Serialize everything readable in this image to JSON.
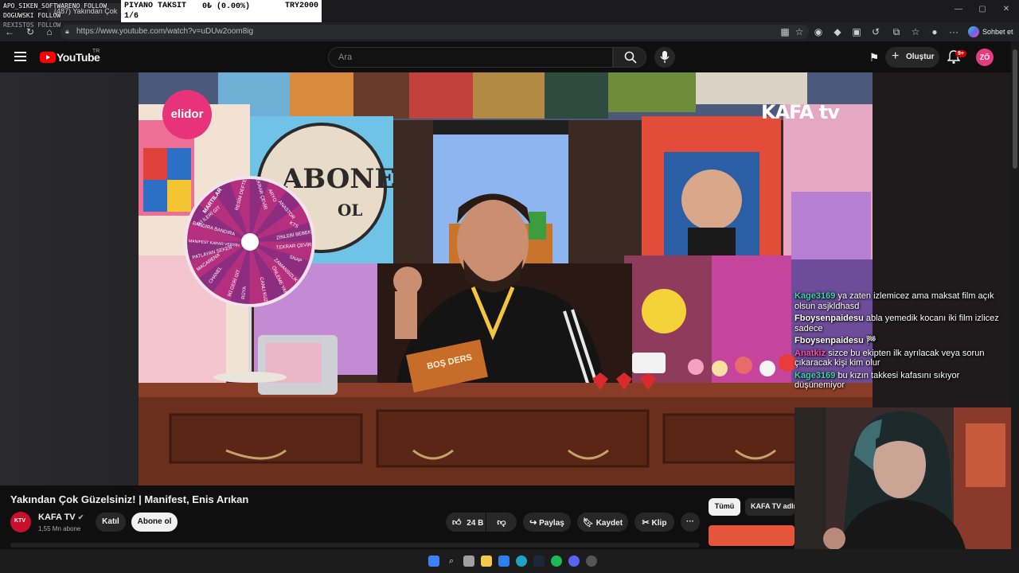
{
  "browser": {
    "tab_partial": "(487) Yakından Çok",
    "url": "https://www.youtube.com/watch?v=uDUw2oom8ig",
    "copilot_label": "Sohbet et"
  },
  "stream_overlay": {
    "follow_lines": [
      "APO_SIKEN_SOFTWARE⁠NO FOLLOW",
      "DOGUWSKI FOLLOW",
      "REXISTOS FOLLOW"
    ],
    "ticker_name": "PIYANO TAKSIT",
    "ticker_amount": "0₺ (0.00%)",
    "ticker_goal": "TRY2000",
    "ticker_step": "1/6"
  },
  "youtube_header": {
    "logo_text": "YouTube",
    "logo_region": "TR",
    "search_placeholder": "Ara",
    "create_label": "Oluştur",
    "notif_count": "9+",
    "user_initials": "ZÖ"
  },
  "video": {
    "title": "Yakından Çok Güzelsiniz! | Manifest, Enis Arıkan",
    "sponsor": "elidor",
    "watermark": "KAFA tv",
    "card_text": "BOŞ DERS",
    "wheel_labels": [
      "MARTILAR",
      "TEKRAR ÇEVİR",
      "ARYO",
      "ANASTOR",
      "KTS",
      "ZİNLEBİ BEBEK",
      "TEKRAR ÇEVİR",
      "SNAP",
      "ZAMANSIZLIK",
      "ÖNLEME YAPAN",
      "CANLI KUZU",
      "RÜYA",
      "İKİ GERİ GİT",
      "CHANEL",
      "MACARENA",
      "PATLAYAN ŞEKER",
      "MANIFEST KARAR VERSİN",
      "BANDIRA BANDIRA",
      "İKİ İLERİ GİT",
      "RESİM DEFTERİ"
    ]
  },
  "chat": [
    {
      "user": "Kage3169",
      "user_color": "#3bd3a8",
      "text": "ya zaten izlemicez ama maksat film açık olsun asjkldhasd"
    },
    {
      "user": "Fboysenpaidesu",
      "user_color": "#ffffff",
      "text": "abla yemedik kocanı iki film izlicez sadece"
    },
    {
      "user": "Fboysenpaidesu",
      "user_color": "#ffffff",
      "text": "🏁"
    },
    {
      "user": "Anatkiz",
      "user_color": "#ff4aa8",
      "text": "sizce bu ekipten ilk ayrılacak veya sorun çıkaracak kişi kim olur"
    },
    {
      "user": "Kage3169",
      "user_color": "#3bd3a8",
      "text": "bu kızın takkesi kafasını sıkıyor düşünemiyor"
    }
  ],
  "channel": {
    "name": "KAFA TV",
    "subscribers": "1,55 Mn abone",
    "join_label": "Katıl",
    "subscribe_label": "Abone ol"
  },
  "actions": {
    "likes": "24 B",
    "share_label": "Paylaş",
    "save_label": "Kaydet",
    "clip_label": "Klip"
  },
  "chips": {
    "all": "Tümü",
    "channel": "KAFA TV adlı"
  },
  "colors": {
    "yt_red": "#ff0000",
    "background": "#0f0f0f",
    "accent_pink": "#e73c7e"
  }
}
